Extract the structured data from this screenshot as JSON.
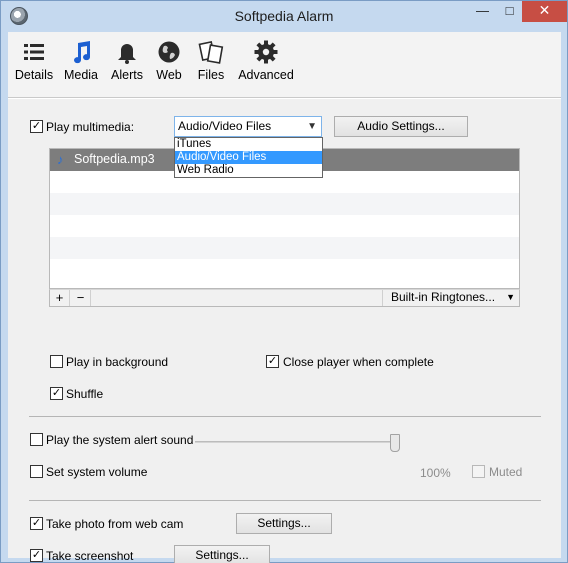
{
  "window": {
    "title": "Softpedia Alarm",
    "minimize": "—",
    "maximize": "□",
    "close": "✕"
  },
  "toolbar": {
    "items": [
      {
        "label": "Details",
        "icon": "list-icon"
      },
      {
        "label": "Media",
        "icon": "music-note-icon"
      },
      {
        "label": "Alerts",
        "icon": "bell-icon"
      },
      {
        "label": "Web",
        "icon": "globe-icon"
      },
      {
        "label": "Files",
        "icon": "files-icon"
      },
      {
        "label": "Advanced",
        "icon": "gear-icon"
      }
    ]
  },
  "media": {
    "play_multimedia_label": "Play multimedia:",
    "play_multimedia_checked": true,
    "source_selected": "Audio/Video Files",
    "source_options": [
      "iTunes",
      "Audio/Video Files",
      "Web Radio"
    ],
    "audio_settings_label": "Audio Settings...",
    "files": [
      "Softpedia.mp3"
    ],
    "add_label": "+",
    "remove_label": "−",
    "ringtones_label": "Built-in Ringtones...",
    "play_background_label": "Play in background",
    "play_background_checked": false,
    "close_player_label": "Close player when complete",
    "close_player_checked": true,
    "shuffle_label": "Shuffle",
    "shuffle_checked": true
  },
  "system": {
    "alert_sound_label": "Play the system alert sound",
    "alert_sound_checked": false,
    "set_volume_label": "Set system volume",
    "set_volume_checked": false,
    "volume_value": "100%",
    "volume_level": 1.0,
    "muted_label": "Muted",
    "muted_checked": false
  },
  "capture": {
    "webcam_label": "Take photo from web cam",
    "webcam_checked": true,
    "webcam_settings_label": "Settings...",
    "screenshot_label": "Take screenshot",
    "screenshot_checked": true,
    "screenshot_settings_label": "Settings..."
  },
  "colors": {
    "selection": "#3399ff",
    "title_bar": "#c5d9ef",
    "close_button": "#c74e44",
    "list_header": "#7d7d7d"
  }
}
